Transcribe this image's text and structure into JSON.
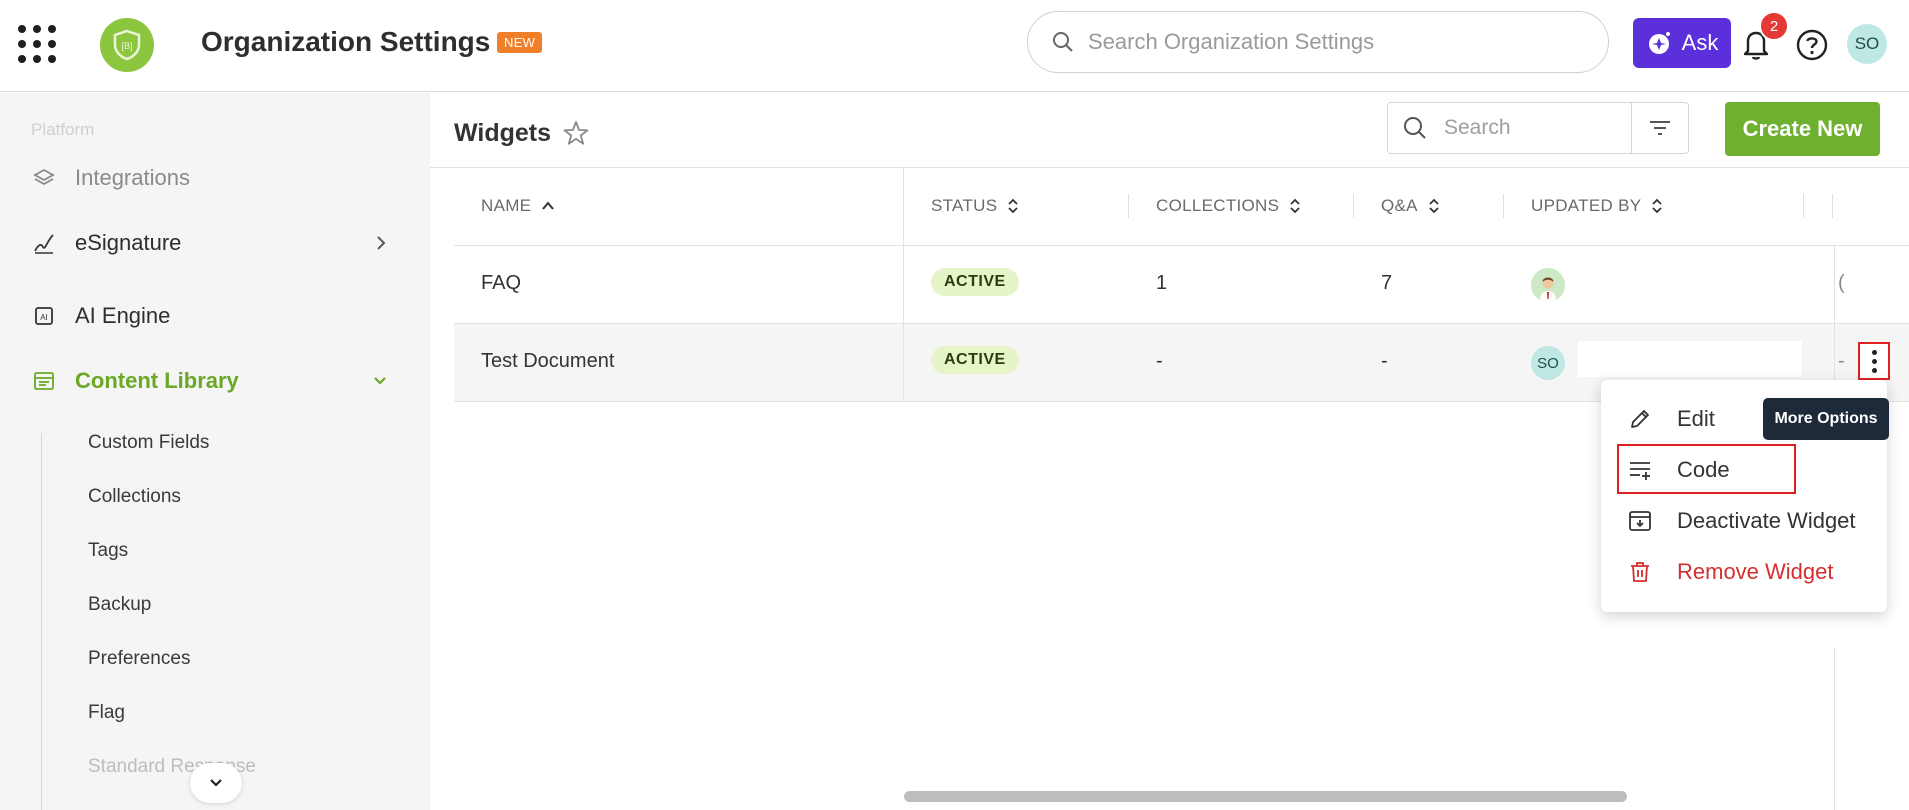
{
  "header": {
    "title": "Organization Settings",
    "new_badge": "NEW",
    "search_placeholder": "Search Organization Settings",
    "ask_label": "Ask",
    "notification_count": "2",
    "user_initials": "SO",
    "logo_text": "[B]"
  },
  "sidebar": {
    "section_label": "Platform",
    "items": [
      {
        "label": "Integrations",
        "icon": "layers-icon"
      },
      {
        "label": "eSignature",
        "icon": "signature-icon"
      },
      {
        "label": "AI Engine",
        "icon": "ai-chip-icon"
      },
      {
        "label": "Content Library",
        "icon": "library-icon"
      }
    ],
    "sub_items": [
      {
        "label": "Custom Fields"
      },
      {
        "label": "Collections"
      },
      {
        "label": "Tags"
      },
      {
        "label": "Backup"
      },
      {
        "label": "Preferences"
      },
      {
        "label": "Flag"
      },
      {
        "label": "Standard Response"
      }
    ]
  },
  "main": {
    "title": "Widgets",
    "search_placeholder": "Search",
    "create_label": "Create New"
  },
  "table": {
    "columns": [
      "NAME",
      "STATUS",
      "COLLECTIONS",
      "Q&A",
      "UPDATED BY"
    ],
    "rows": [
      {
        "name": "FAQ",
        "status": "ACTIVE",
        "collections": "1",
        "qa": "7",
        "updated_by": "avatar",
        "trail": "("
      },
      {
        "name": "Test Document",
        "status": "ACTIVE",
        "collections": "-",
        "qa": "-",
        "updated_by": "SO",
        "trail": "-"
      }
    ]
  },
  "menu": {
    "items": [
      {
        "label": "Edit",
        "icon": "pencil-icon"
      },
      {
        "label": "Code",
        "icon": "code-list-icon"
      },
      {
        "label": "Deactivate Widget",
        "icon": "archive-icon"
      },
      {
        "label": "Remove Widget",
        "icon": "trash-icon"
      }
    ],
    "tooltip": "More Options"
  },
  "colors": {
    "brand_green": "#6eb02f",
    "ask_purple": "#5b2fd9",
    "danger_red": "#d32f2f",
    "new_orange": "#f07f2a"
  }
}
